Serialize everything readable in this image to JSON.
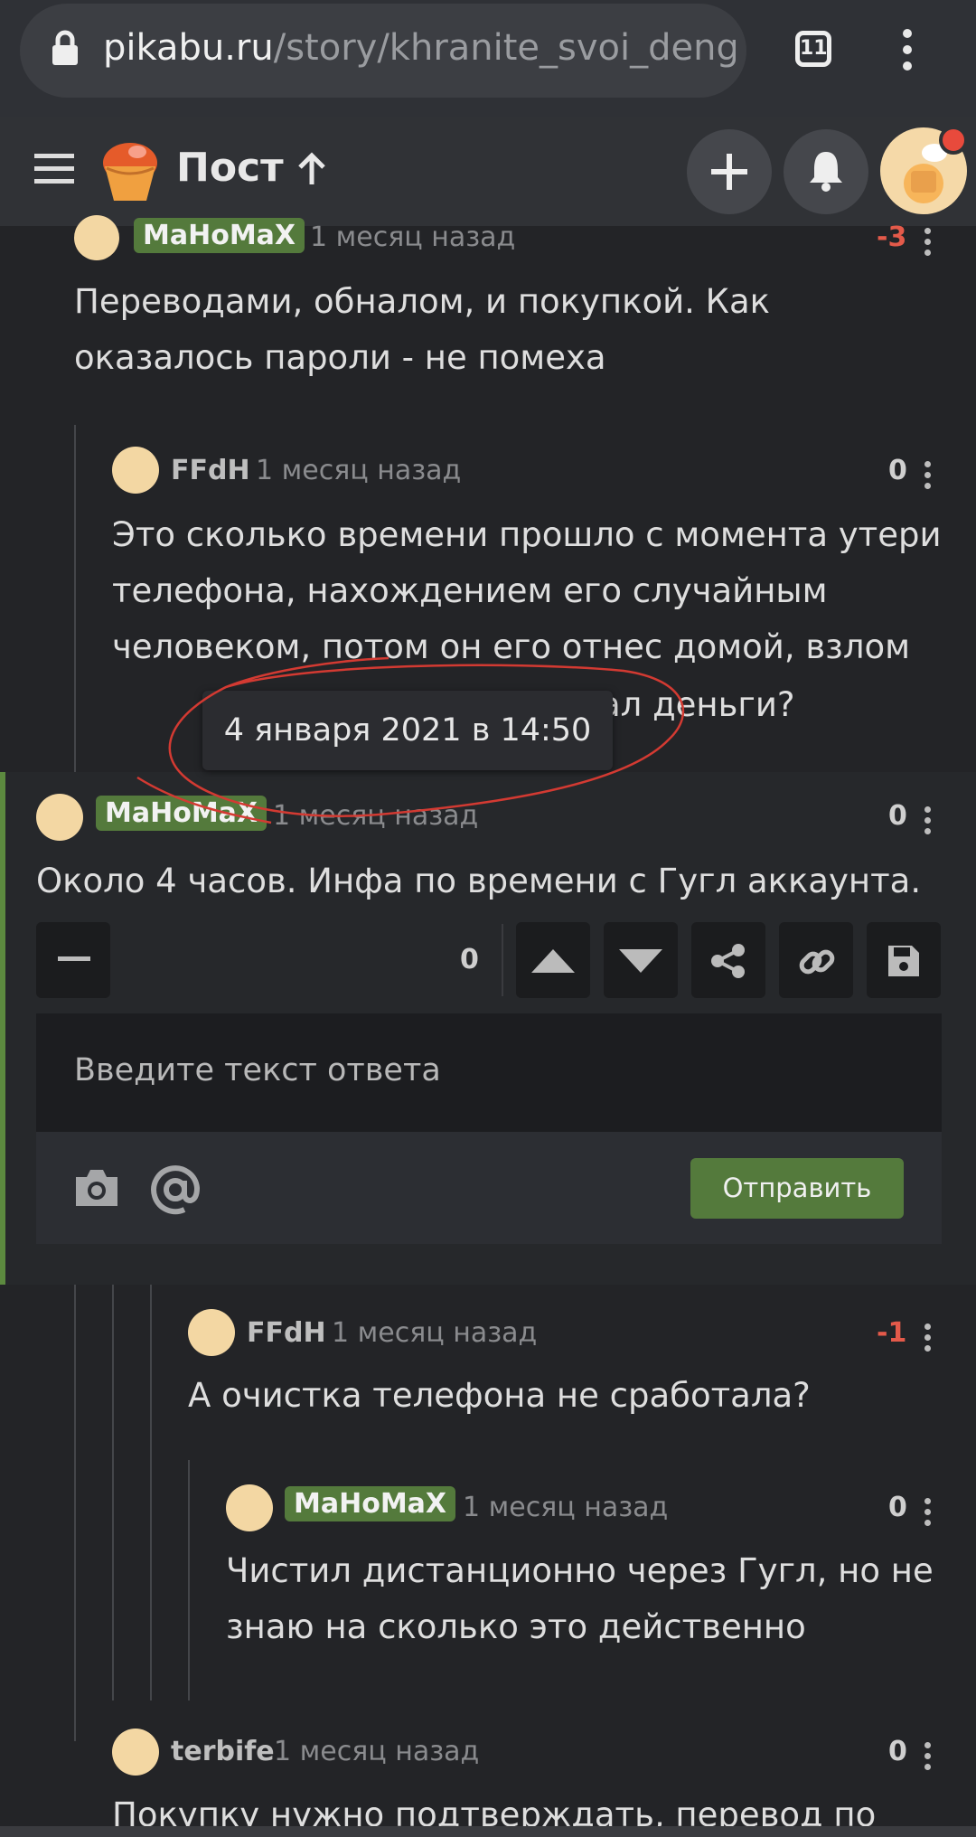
{
  "browser": {
    "url_host": "pikabu.ru",
    "url_path": "/story/khranite_svoi_dengi_",
    "tab_count": "11"
  },
  "header": {
    "title": "Пост"
  },
  "comments": [
    {
      "user": "MaHoMaX",
      "op_badge": true,
      "time": "1 месяц назад",
      "rating": "-3",
      "text": "Переводами, обналом, и покупкой. Как оказалось пароли - не помеха"
    },
    {
      "user": "FFdH",
      "op_badge": false,
      "time": "1 месяц назад",
      "rating": "0",
      "text": "Это сколько времени прошло с момента утери телефона, нахождением его случайным человеком, потом он его отнес домой, взлом",
      "text_tail": "ал деньги?"
    },
    {
      "user": "MaHoMaX",
      "op_badge": true,
      "time": "1 месяц назад",
      "rating": "0",
      "text": "Около 4 часов. Инфа по времени с Гугл аккаунта."
    },
    {
      "user": "FFdH",
      "op_badge": false,
      "time": "1 месяц назад",
      "rating": "-1",
      "text": "А очистка телефона не сработала?"
    },
    {
      "user": "MaHoMaX",
      "op_badge": true,
      "time": "1 месяц назад",
      "rating": "0",
      "text": "Чистил дистанционно через Гугл, но не знаю на сколько это действенно"
    },
    {
      "user": "terbife",
      "op_badge": false,
      "time": "1 месяц назад",
      "rating": "0",
      "text": "Покупку нужно подтверждать, перевод по"
    }
  ],
  "tooltip": "4 января 2021 в 14:50",
  "actions": {
    "score": "0"
  },
  "reply": {
    "placeholder": "Введите текст ответа",
    "send_label": "Отправить"
  },
  "colors": {
    "accent_green": "#547a3c",
    "negative": "#e45a4a",
    "annotation": "#d33a32"
  },
  "icons": [
    "lock-icon",
    "tabs-icon",
    "menu-icon",
    "hamburger-icon",
    "logo-icon",
    "arrow-up-icon",
    "plus-icon",
    "bell-icon",
    "minus-icon",
    "upvote-icon",
    "downvote-icon",
    "share-icon",
    "link-icon",
    "save-icon",
    "camera-icon",
    "mention-icon"
  ]
}
